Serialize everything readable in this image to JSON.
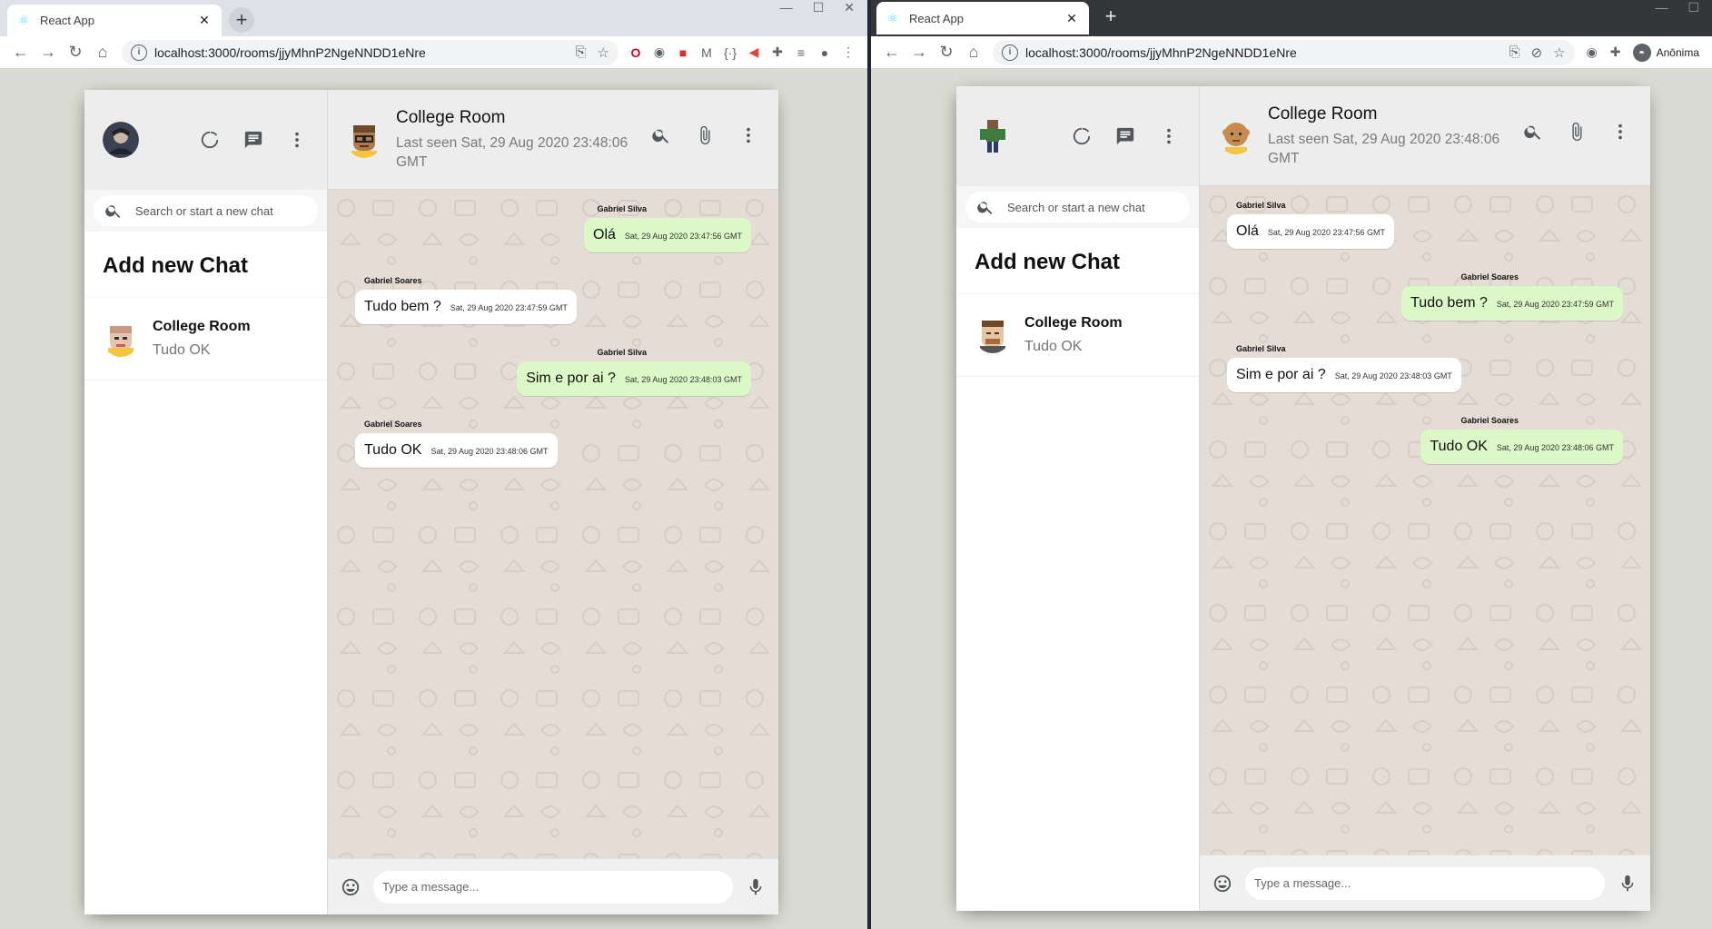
{
  "browser": {
    "tab_title": "React App",
    "url": "localhost:3000/rooms/jjyMhnP2NgeNNDD1eNre",
    "profile_label": "Anônima"
  },
  "app": {
    "search_placeholder": "Search or start a new chat",
    "add_new_chat": "Add new Chat",
    "room_name": "College Room",
    "room_last_message": "Tudo OK",
    "last_seen": "Last seen Sat, 29 Aug 2020 23:48:06 GMT",
    "message_placeholder": "Type a message..."
  },
  "left": {
    "messages": [
      {
        "name": "Gabriel Silva",
        "text": "Olá",
        "time": "Sat, 29 Aug 2020 23:47:56 GMT",
        "sent": true
      },
      {
        "name": "Gabriel Soares",
        "text": "Tudo bem ?",
        "time": "Sat, 29 Aug 2020 23:47:59 GMT",
        "sent": false
      },
      {
        "name": "Gabriel Silva",
        "text": "Sim e por ai ?",
        "time": "Sat, 29 Aug 2020 23:48:03 GMT",
        "sent": true
      },
      {
        "name": "Gabriel Soares",
        "text": "Tudo OK",
        "time": "Sat, 29 Aug 2020 23:48:06 GMT",
        "sent": false
      }
    ]
  },
  "right": {
    "messages": [
      {
        "name": "Gabriel Silva",
        "text": "Olá",
        "time": "Sat, 29 Aug 2020 23:47:56 GMT",
        "sent": false
      },
      {
        "name": "Gabriel Soares",
        "text": "Tudo bem ?",
        "time": "Sat, 29 Aug 2020 23:47:59 GMT",
        "sent": true
      },
      {
        "name": "Gabriel Silva",
        "text": "Sim e por ai ?",
        "time": "Sat, 29 Aug 2020 23:48:03 GMT",
        "sent": false
      },
      {
        "name": "Gabriel Soares",
        "text": "Tudo OK",
        "time": "Sat, 29 Aug 2020 23:48:06 GMT",
        "sent": true
      }
    ]
  },
  "colors": {
    "app_bg": "#dadbd3",
    "sent_bubble": "#dcf8c6",
    "recv_bubble": "#ffffff",
    "chat_bg": "#e5ddd5",
    "dark_chrome": "#35363a"
  }
}
